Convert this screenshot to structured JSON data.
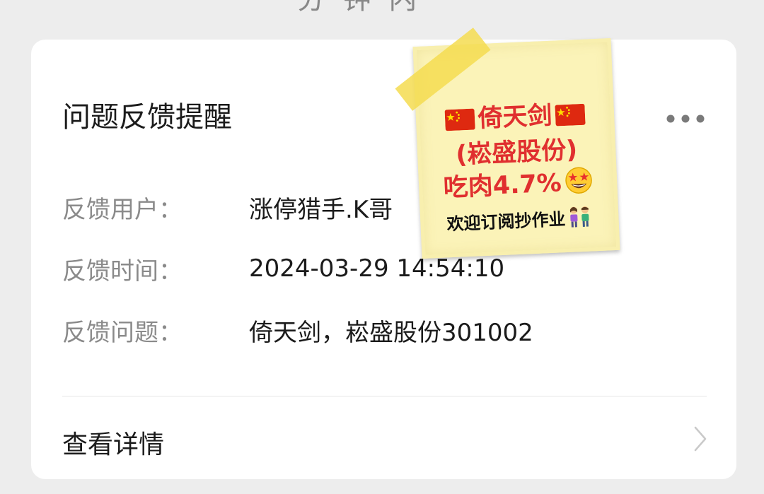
{
  "top_fragment": "分 钟 内",
  "card": {
    "title": "问题反馈提醒",
    "rows": [
      {
        "label": "反馈用户：",
        "value": "涨停猎手.K哥"
      },
      {
        "label": "反馈时间：",
        "value": "2024-03-29 14:54:10"
      },
      {
        "label": "反馈问题：",
        "value": "倚天剑，崧盛股份301002"
      }
    ],
    "detail_label": "查看详情"
  },
  "sticker": {
    "line1": "倚天剑",
    "line2": "(崧盛股份)",
    "line3": "吃肉4.7%",
    "line4": "欢迎订阅抄作业"
  },
  "icons": {
    "more": "more-horizontal-icon",
    "chevron": "chevron-right-icon",
    "flag": "china-flag-icon",
    "star_eyes": "star-struck-emoji-icon",
    "people": "two-people-emoji-icon"
  },
  "colors": {
    "background": "#ededed",
    "card": "#ffffff",
    "sticker_bg": "#fbf3b8",
    "sticker_red": "#e02f2f",
    "tape": "#f4dc50"
  }
}
